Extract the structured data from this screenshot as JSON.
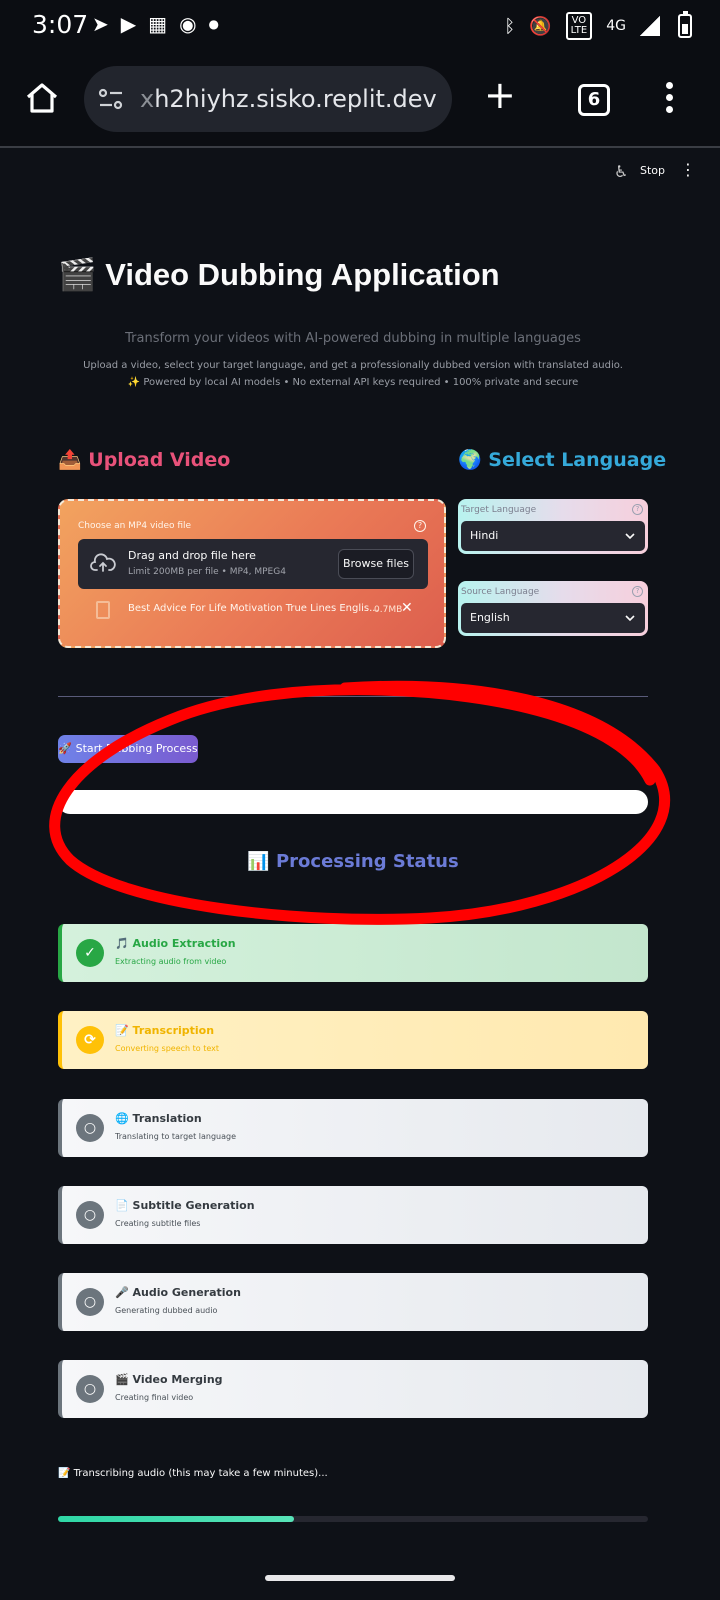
{
  "status_bar": {
    "time": "3:07",
    "volte": "VO\nLTE",
    "network": "4G",
    "left_icons": [
      "telegram-icon",
      "youtube-icon",
      "gallery-icon",
      "incognito-icon",
      "dot-icon"
    ],
    "right_icons": [
      "bluetooth-icon",
      "mute-icon",
      "volte-icon",
      "signal-icon",
      "battery-icon"
    ]
  },
  "browser": {
    "url_prefix": "x",
    "url": "h2hiyhz.sisko.replit.dev",
    "tab_count": "6",
    "plus_label": "+"
  },
  "app_toolbar": {
    "stop_label": "Stop",
    "more_label": "⋮",
    "running_icon": "♿"
  },
  "header": {
    "title": "🎬 Video Dubbing Application",
    "tagline": "Transform your videos with AI-powered dubbing in multiple languages",
    "description_1": "Upload a video, select your target language, and get a professionally dubbed version with translated audio.",
    "description_2": "✨ Powered by local AI models • No external API keys required • 100% private and secure"
  },
  "upload": {
    "heading": "📤 Upload Video",
    "label": "Choose an MP4 video file",
    "help": "?",
    "dropzone_title": "Drag and drop file here",
    "dropzone_limit": "Limit 200MB per file • MP4, MPEG4",
    "browse_label": "Browse files",
    "file_name": "Best Advice For Life Motivation True Lines Englis...",
    "file_size": "0.7MB",
    "remove_label": "✕"
  },
  "language": {
    "heading": "🌍 Select Language",
    "target_label": "Target Language",
    "target_value": "Hindi",
    "source_label": "Source Language",
    "source_value": "English",
    "help": "?"
  },
  "actions": {
    "start_label": "🚀 Start Dubbing Process"
  },
  "status": {
    "heading": "📊 Processing Status",
    "steps": [
      {
        "icon": "✓",
        "title": "🎵 Audio Extraction",
        "subtitle": "Extracting audio from video",
        "state": "done"
      },
      {
        "icon": "⟳",
        "title": "📝 Transcription",
        "subtitle": "Converting speech to text",
        "state": "active"
      },
      {
        "icon": "○",
        "title": "🌐 Translation",
        "subtitle": "Translating to target language",
        "state": "pending"
      },
      {
        "icon": "○",
        "title": "📄 Subtitle Generation",
        "subtitle": "Creating subtitle files",
        "state": "pending"
      },
      {
        "icon": "○",
        "title": "🎤 Audio Generation",
        "subtitle": "Generating dubbed audio",
        "state": "pending"
      },
      {
        "icon": "○",
        "title": "🎬 Video Merging",
        "subtitle": "Creating final video",
        "state": "pending"
      }
    ],
    "message": "📝 Transcribing audio (this may take a few minutes)...",
    "progress": 0.4
  },
  "colors": {
    "upload_heading": "#e8527a",
    "language_heading": "#35a9d9",
    "status_heading": "#6b7bd6",
    "done": "#28a745",
    "active": "#ffc107",
    "pending": "#6c757d",
    "annotation": "#ff0000"
  }
}
